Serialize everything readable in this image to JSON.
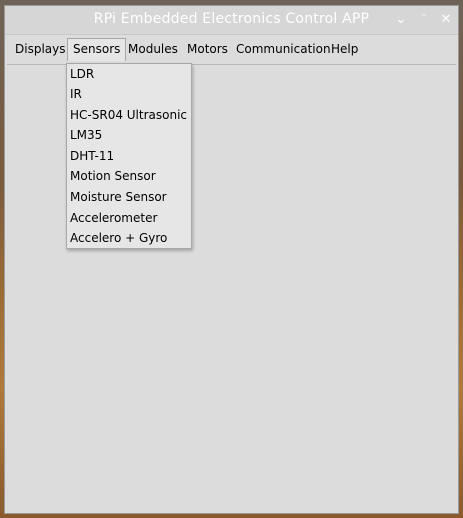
{
  "window": {
    "title": "RPi Embedded Electronics Control APP",
    "controls": {
      "minimize": "⌄",
      "maximize": "⌃",
      "close": "✕"
    }
  },
  "menubar": {
    "items": [
      {
        "label": "Displays"
      },
      {
        "label": "Sensors",
        "active": true
      },
      {
        "label": "Modules"
      },
      {
        "label": "Motors"
      },
      {
        "label": "Communication"
      },
      {
        "label": "Help"
      }
    ]
  },
  "sensors_menu": {
    "items": [
      {
        "label": "LDR"
      },
      {
        "label": "IR"
      },
      {
        "label": "HC-SR04 Ultrasonic"
      },
      {
        "label": "LM35"
      },
      {
        "label": "DHT-11"
      },
      {
        "label": "Motion Sensor"
      },
      {
        "label": "Moisture Sensor"
      },
      {
        "label": "Accelerometer"
      },
      {
        "label": "Accelero + Gyro"
      }
    ]
  }
}
